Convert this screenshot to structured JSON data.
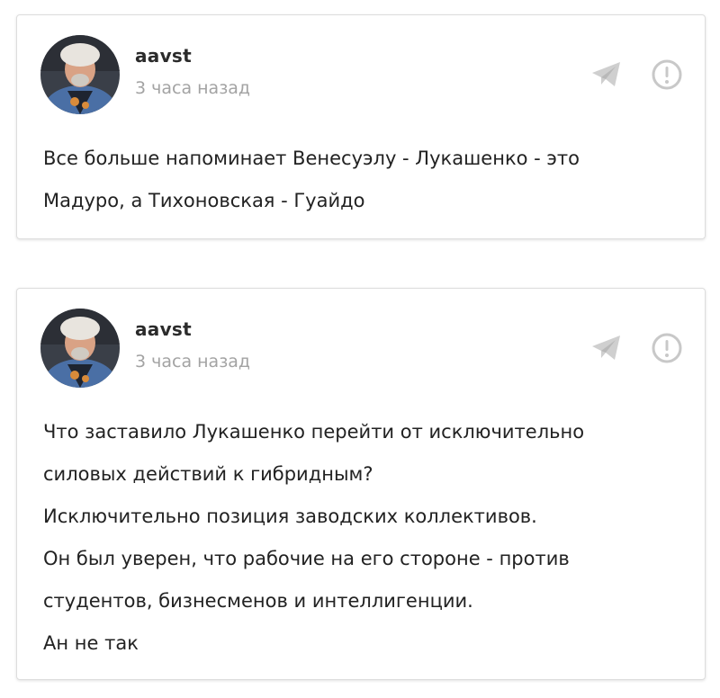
{
  "posts": [
    {
      "author": "aavst",
      "time": "3 часа назад",
      "lines": [
        "Все больше напоминает Венесуэлу - Лукашенко - это",
        "Мадуро, а Тихоновская - Гуайдо"
      ]
    },
    {
      "author": "aavst",
      "time": "3 часа назад",
      "lines": [
        "Что заставило Лукашенко перейти от исключительно",
        "силовых действий к гибридным?",
        "Исключительно позиция заводских коллективов.",
        "Он был уверен, что рабочие на его стороне - против",
        "студентов, бизнесменов и интеллигенции.",
        "Ан не так"
      ]
    }
  ],
  "icons": {
    "share": "telegram-share-icon",
    "report": "report-exclamation-icon"
  },
  "colors": {
    "icon": "#c8c8c8",
    "author": "#2b2b2b",
    "time": "#a3a3a3",
    "text": "#222222",
    "border": "#dddddd"
  }
}
